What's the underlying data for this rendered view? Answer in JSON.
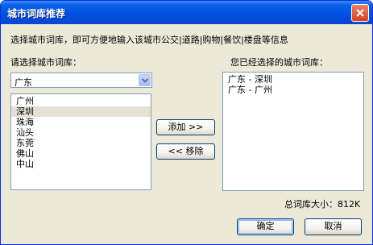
{
  "window": {
    "title": "城市词库推荐"
  },
  "description": "选择城市词库，即可方便地输入该城市公交|道路|购物|餐饮|楼盘等信息",
  "left_label": "请选择城市词库：",
  "right_label": "您已经选择的城市词库：",
  "province_select": {
    "value": "广东"
  },
  "city_list": [
    "广州",
    "深圳",
    "珠海",
    "汕头",
    "东莞",
    "佛山",
    "中山"
  ],
  "city_selected": "深圳",
  "selected_list": [
    "广东 - 深圳",
    "广东 - 广州"
  ],
  "buttons": {
    "add": "添加 >>",
    "remove": "<< 移除",
    "ok": "确定",
    "cancel": "取消"
  },
  "total_size": {
    "label": "总词库大小：",
    "value": "812K"
  }
}
